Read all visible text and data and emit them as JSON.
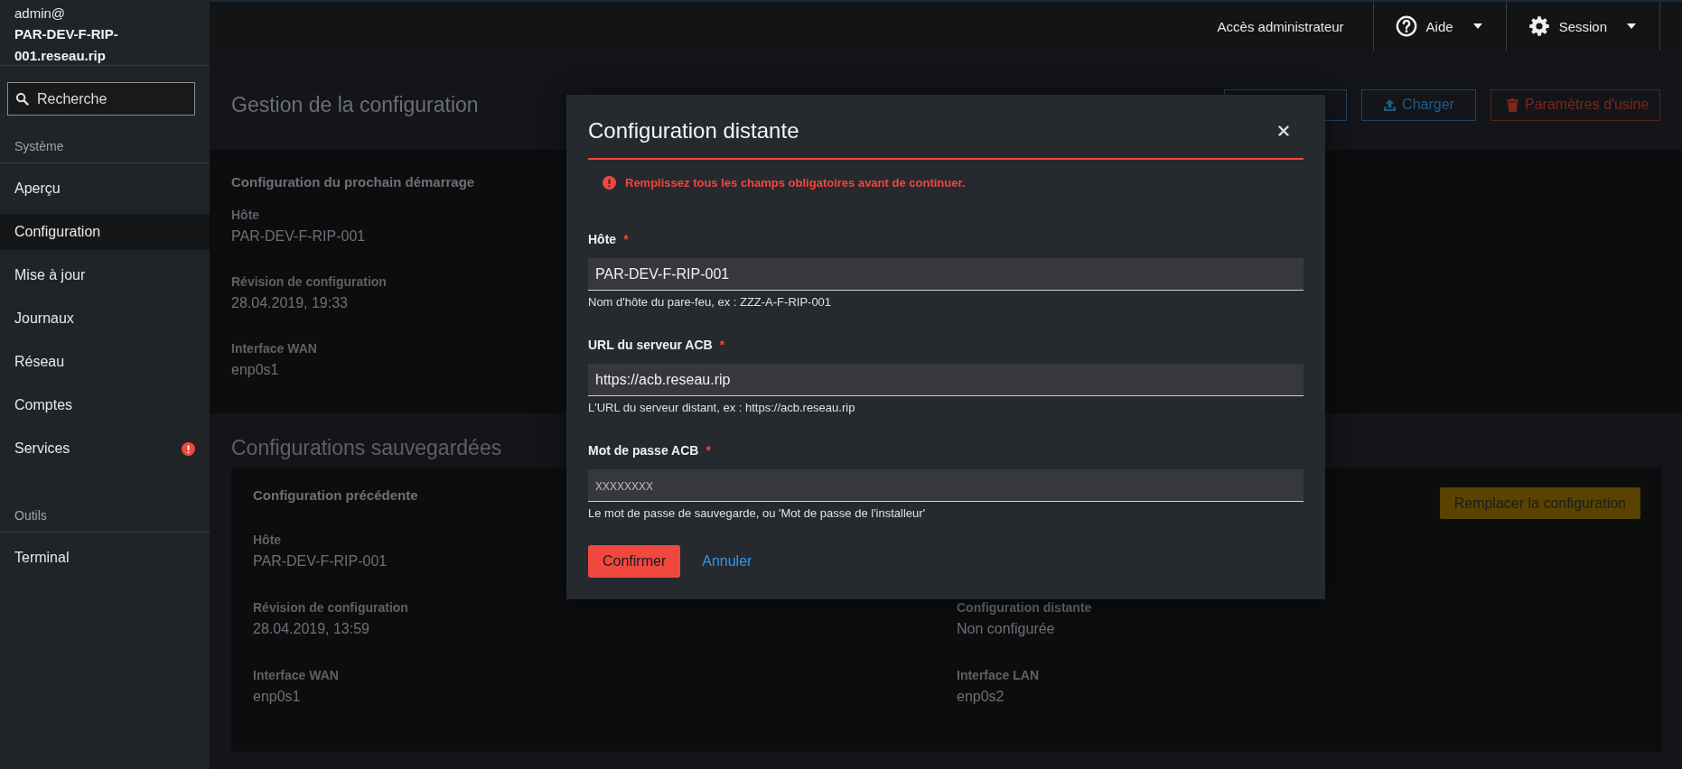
{
  "sidebar": {
    "user": "admin@",
    "host": "PAR-DEV-F-RIP-001.reseau.rip",
    "search": {
      "placeholder": "Recherche"
    },
    "sections": [
      {
        "title": "Système",
        "items": [
          {
            "label": "Aperçu",
            "selected": false,
            "alert": false
          },
          {
            "label": "Configuration",
            "selected": true,
            "alert": false
          },
          {
            "label": "Mise à jour",
            "selected": false,
            "alert": false
          },
          {
            "label": "Journaux",
            "selected": false,
            "alert": false
          },
          {
            "label": "Réseau",
            "selected": false,
            "alert": false
          },
          {
            "label": "Comptes",
            "selected": false,
            "alert": false
          },
          {
            "label": "Services",
            "selected": false,
            "alert": true
          }
        ]
      },
      {
        "title": "Outils",
        "items": [
          {
            "label": "Terminal",
            "selected": false,
            "alert": false
          }
        ]
      }
    ]
  },
  "top_bar": {
    "admin_link": "Accès administrateur",
    "menus": [
      {
        "kind": "help",
        "label": "Aide"
      },
      {
        "kind": "settings",
        "label": "Session"
      }
    ]
  },
  "page": {
    "title": "Gestion de la configuration",
    "actions": [
      {
        "kind": "plain"
      },
      {
        "kind": "upload",
        "label": "Charger"
      },
      {
        "kind": "danger",
        "label": "Paramètres d'usine"
      }
    ]
  },
  "next_boot": {
    "title": "Configuration du prochain démarrage",
    "fields": [
      {
        "label": "Hôte",
        "value": "PAR-DEV-F-RIP-001"
      },
      {
        "label": "Révision de configuration",
        "value": "28.04.2019, 19:33"
      },
      {
        "label": "Interface WAN",
        "value": "enp0s1"
      }
    ]
  },
  "saved": {
    "title": "Configurations sauvegardées",
    "card": {
      "title": "Configuration précédente",
      "button": "Remplacer la configuration",
      "rows": [
        [
          {
            "label": "Hôte",
            "value": "PAR-DEV-F-RIP-001"
          }
        ],
        [
          {
            "label": "Révision de configuration",
            "value": "28.04.2019, 13:59"
          },
          {
            "label": "Configuration distante",
            "value": "Non configurée"
          }
        ],
        [
          {
            "label": "Interface WAN",
            "value": "enp0s1"
          },
          {
            "label": "Interface LAN",
            "value": "enp0s2"
          }
        ]
      ]
    }
  },
  "dialog": {
    "title": "Configuration distante",
    "error": "Remplissez tous les champs obligatoires avant de continuer.",
    "fields": [
      {
        "label": "Hôte",
        "required_mark": "*",
        "value": "PAR-DEV-F-RIP-001",
        "hint": "Nom d'hôte du pare-feu, ex : ZZZ-A-F-RIP-001"
      },
      {
        "label": "URL du serveur ACB",
        "required_mark": "*",
        "value": "https://acb.reseau.rip",
        "hint": "L'URL du serveur distant, ex : https://acb.reseau.rip"
      },
      {
        "label": "Mot de passe ACB",
        "required_mark": "*",
        "placeholder": "xxxxxxxx",
        "hint": "Le mot de passe de sauvegarde, ou 'Mot de passe de l'installeur'"
      }
    ],
    "confirm": "Confirmer",
    "cancel": "Annuler"
  }
}
